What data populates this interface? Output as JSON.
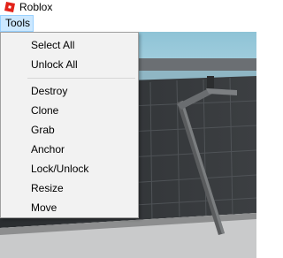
{
  "window": {
    "title": "Roblox",
    "icon": "roblox-logo-icon",
    "accent": "#e2231a"
  },
  "menubar": {
    "tools_label": "Tools"
  },
  "tools_menu": {
    "group1": [
      "Select All",
      "Unlock All"
    ],
    "group2": [
      "Destroy",
      "Clone",
      "Grab",
      "Anchor",
      "Lock/Unlock",
      "Resize",
      "Move"
    ]
  }
}
